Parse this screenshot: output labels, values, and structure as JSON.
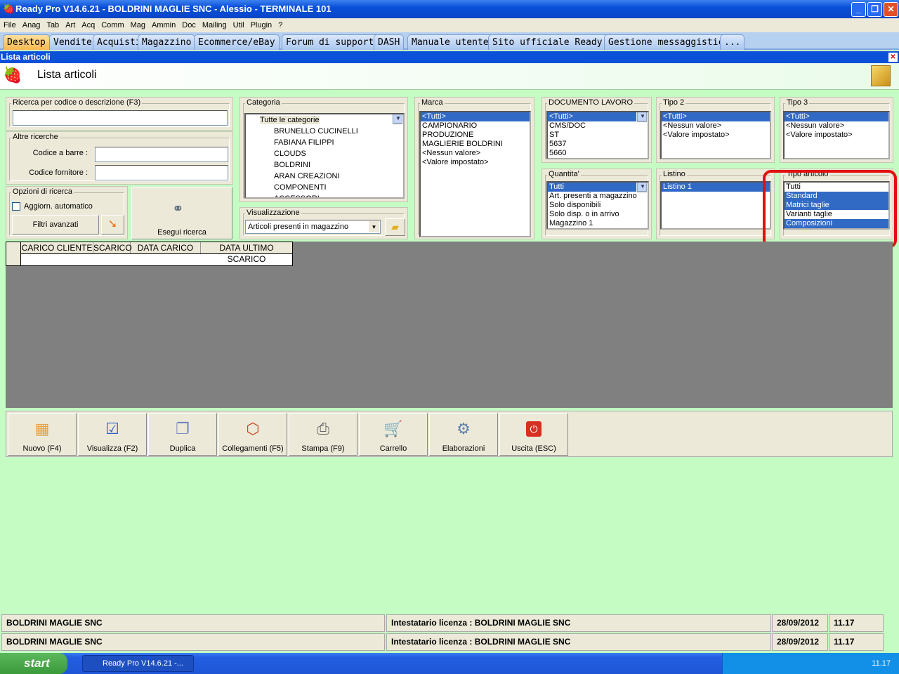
{
  "window": {
    "title": "Ready Pro V14.6.21 - BOLDRINI MAGLIE SNC - Alessio - TERMINALE 101",
    "minimize": "_",
    "restore": "❐",
    "close": "✕"
  },
  "menu": [
    "File",
    "Anag",
    "Tab",
    "Art",
    "Acq",
    "Comm",
    "Mag",
    "Ammin",
    "Doc",
    "Mailing",
    "Util",
    "Plugin",
    "?"
  ],
  "tabs": [
    "Desktop",
    "Vendite",
    "Acquisti",
    "Magazzino",
    "Ecommerce/eBay",
    "Forum di supporto",
    "DASH",
    "Manuale utente",
    "Sito ufficiale Ready Pro",
    "Gestione messaggistica",
    "..."
  ],
  "subwindow": {
    "title": "Lista articoli",
    "close": "✕"
  },
  "header": {
    "title": "Lista articoli"
  },
  "search": {
    "legend": "Ricerca per codice o descrizione (F3)",
    "value": ""
  },
  "altre": {
    "legend": "Altre ricerche",
    "barcode_label": "Codice a barre :",
    "supplier_label": "Codice fornitore :"
  },
  "opzioni": {
    "legend": "Opzioni di ricerca",
    "auto_update": "Aggiorn. automatico",
    "advanced_filters": "Filtri avanzati",
    "run_search": "Esegui ricerca"
  },
  "categoria": {
    "legend": "Categoria",
    "root": "Tutte le categorie",
    "items": [
      "BRUNELLO CUCINELLI",
      "FABIANA FILIPPI",
      "CLOUDS",
      "BOLDRINI",
      "ARAN CREAZIONI",
      "COMPONENTI",
      "ACCESSORI"
    ]
  },
  "visualizzazione": {
    "legend": "Visualizzazione",
    "selected": "Articoli presenti in magazzino"
  },
  "marca": {
    "legend": "Marca",
    "items": [
      "<Tutti>",
      "CAMPIONARIO",
      "PRODUZIONE",
      "MAGLIERIE BOLDRINI",
      "<Nessun valore>",
      "<Valore impostato>"
    ]
  },
  "documento": {
    "legend": "DOCUMENTO LAVORO",
    "items": [
      "<Tutti>",
      "CMS/DOC",
      "ST",
      "5637",
      "5660"
    ]
  },
  "tipo2": {
    "legend": "Tipo 2",
    "items": [
      "<Tutti>",
      "<Nessun valore>",
      "<Valore impostato>"
    ]
  },
  "tipo3": {
    "legend": "Tipo 3",
    "items": [
      "<Tutti>",
      "<Nessun valore>",
      "<Valore impostato>"
    ]
  },
  "quantita": {
    "legend": "Quantita'",
    "items": [
      "Tutti",
      "Art. presenti a magazzino",
      "Solo disponibili",
      "Solo disp. o in arrivo",
      "Magazzino 1"
    ]
  },
  "listino": {
    "legend": "Listino",
    "items": [
      "Listino 1"
    ]
  },
  "tipo_articolo": {
    "legend": "Tipo articolo",
    "items": [
      "Tutti",
      "Standard",
      "Matrici taglie",
      "Varianti taglie",
      "Composizioni"
    ]
  },
  "grid": {
    "columns": [
      "CARICO CLIENTE",
      "SCARICO",
      "DATA CARICO",
      "DATA ULTIMO SCARICO"
    ]
  },
  "toolbar": [
    "Nuovo (F4)",
    "Visualizza (F2)",
    "Duplica",
    "Collegamenti (F5)",
    "Stampa (F9)",
    "Carrello",
    "Elaborazioni",
    "Uscita (ESC)"
  ],
  "status": {
    "company": "BOLDRINI MAGLIE SNC",
    "license": "Intestatario licenza : BOLDRINI MAGLIE SNC",
    "date": "28/09/2012",
    "time": "11.17"
  },
  "taskbar": {
    "start": "start",
    "task": "Ready Pro V14.6.21 -...",
    "clock": "11.17"
  },
  "colors": {
    "selection": "#316ac5",
    "highlight": "#e01010",
    "background": "#c4fcc4"
  }
}
